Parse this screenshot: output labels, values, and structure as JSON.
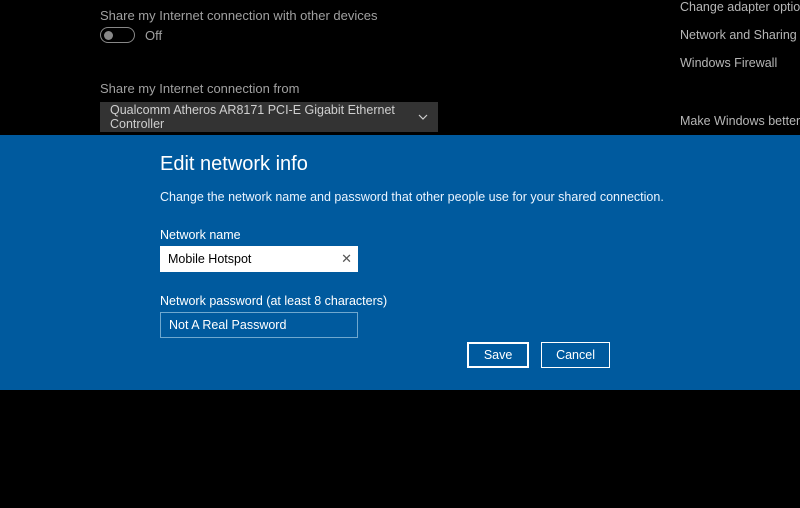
{
  "background": {
    "share_toggle_label": "Share my Internet connection with other devices",
    "toggle_state": "Off",
    "share_from_label": "Share my Internet connection from",
    "share_from_value": "Qualcomm Atheros AR8171 PCI-E Gigabit Ethernet Controller",
    "network_name_key": "Network name:",
    "network_name_val": "Mobile Hotspot"
  },
  "right_links": {
    "link1": "Change adapter options",
    "link2": "Network and Sharing Center",
    "link3": "Windows Firewall",
    "make": "Make Windows better"
  },
  "modal": {
    "title": "Edit network info",
    "subtitle": "Change the network name and password that other people use for your shared connection.",
    "name_label": "Network name",
    "name_value": "Mobile Hotspot",
    "password_label": "Network password (at least 8 characters)",
    "password_value": "Not A Real Password",
    "save_label": "Save",
    "cancel_label": "Cancel"
  }
}
